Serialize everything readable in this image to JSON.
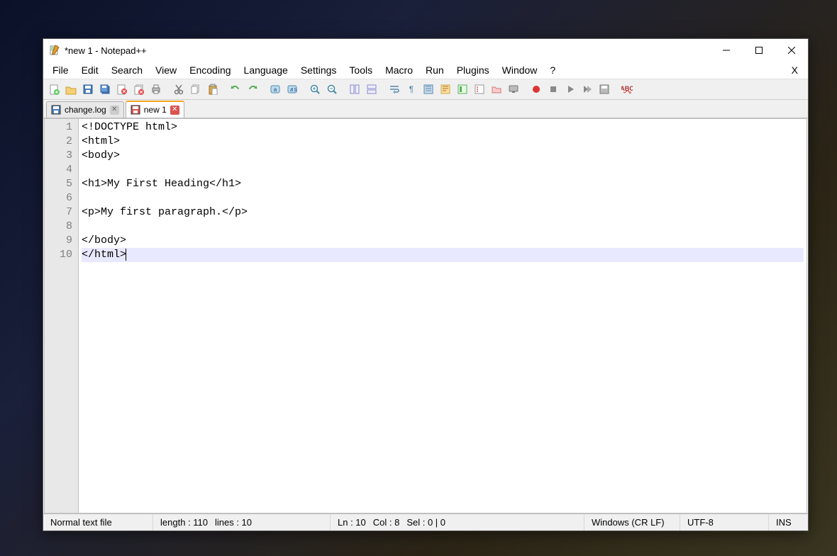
{
  "title": "*new 1 - Notepad++",
  "menu": [
    "File",
    "Edit",
    "Search",
    "View",
    "Encoding",
    "Language",
    "Settings",
    "Tools",
    "Macro",
    "Run",
    "Plugins",
    "Window",
    "?"
  ],
  "menu_right": "X",
  "tabs": [
    {
      "label": "change.log",
      "icon": "disk-blue",
      "active": false,
      "close_style": "gray"
    },
    {
      "label": "new 1",
      "icon": "disk-red",
      "active": true,
      "close_style": "red"
    }
  ],
  "toolbar_icons": [
    "new-file-icon",
    "open-file-icon",
    "save-icon",
    "save-all-icon",
    "close-icon",
    "close-all-icon",
    "print-icon",
    "|",
    "cut-icon",
    "copy-icon",
    "paste-icon",
    "|",
    "undo-icon",
    "redo-icon",
    "|",
    "find-icon",
    "replace-icon",
    "|",
    "zoom-in-icon",
    "zoom-out-icon",
    "|",
    "sync-v-icon",
    "sync-h-icon",
    "|",
    "wrap-icon",
    "all-chars-icon",
    "indent-guide-icon",
    "udl-icon",
    "doc-map-icon",
    "func-list-icon",
    "folder-icon",
    "monitor-icon",
    "|",
    "record-icon",
    "stop-icon",
    "play-icon",
    "play-multi-icon",
    "save-macro-icon",
    "|",
    "spellcheck-icon"
  ],
  "code_lines": [
    "<!DOCTYPE html>",
    "<html>",
    "<body>",
    "",
    "<h1>My First Heading</h1>",
    "",
    "<p>My first paragraph.</p>",
    "",
    "</body>",
    "</html>"
  ],
  "current_line": 10,
  "status": {
    "filetype": "Normal text file",
    "length_label": "length : 110",
    "lines_label": "lines : 10",
    "ln_label": "Ln : 10",
    "col_label": "Col : 8",
    "sel_label": "Sel : 0 | 0",
    "eol": "Windows (CR LF)",
    "encoding": "UTF-8",
    "ins": "INS"
  }
}
